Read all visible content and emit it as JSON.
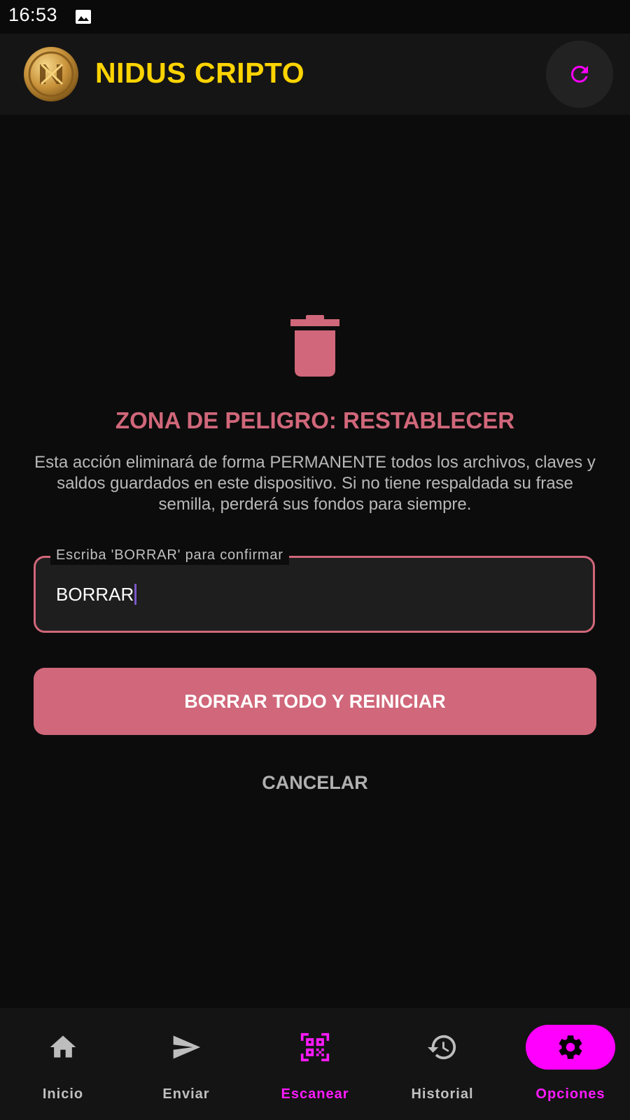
{
  "status_bar": {
    "time": "16:53",
    "icons": [
      "image-icon"
    ]
  },
  "app_bar": {
    "title": "NIDUS CRIPTO",
    "logo": "nidus-logo",
    "refresh_icon": "refresh-icon"
  },
  "danger_zone": {
    "icon": "trash-icon",
    "title": "ZONA DE PELIGRO: RESTABLECER",
    "description": "Esta acción eliminará de forma PERMANENTE todos los archivos, claves y saldos guardados en este dispositivo. Si no tiene respaldada su frase semilla, perderá sus fondos para siempre.",
    "field_label": "Escriba 'BORRAR' para confirmar",
    "field_value": "BORRAR",
    "reset_button_label": "BORRAR TODO Y REINICIAR",
    "cancel_button_label": "CANCELAR"
  },
  "bottom_nav": {
    "items": [
      {
        "label": "Inicio",
        "icon": "home-icon",
        "active": false
      },
      {
        "label": "Enviar",
        "icon": "send-icon",
        "active": false
      },
      {
        "label": "Escanear",
        "icon": "qr-scan-icon",
        "active": false
      },
      {
        "label": "Historial",
        "icon": "history-icon",
        "active": false
      },
      {
        "label": "Opciones",
        "icon": "gear-icon",
        "active": true
      }
    ]
  },
  "colors": {
    "background": "#0c0c0c",
    "brand_yellow": "#ffd400",
    "accent_magenta": "#ff00ff",
    "danger": "#d0677a"
  }
}
